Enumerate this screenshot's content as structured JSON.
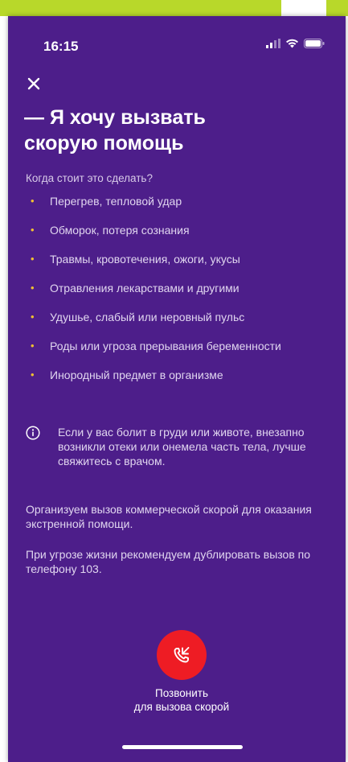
{
  "status": {
    "time": "16:15"
  },
  "header": {
    "close_icon": "close-icon",
    "title_line1": "— Я хочу вызвать",
    "title_line2": "скорую помощь"
  },
  "main": {
    "subtitle": "Когда стоит это сделать?",
    "symptoms": [
      "Перегрев, тепловой удар",
      "Обморок, потеря сознания",
      "Травмы, кровотечения, ожоги, укусы",
      "Отравления лекарствами и другими",
      "Удушье, слабый или неровный пульс",
      "Роды или угроза прерывания беременности",
      "Инородный предмет в организме"
    ],
    "notice": "Если у вас болит в груди или животе, внезапно возникли отеки или онемела часть тела, лучше свяжитесь с врачом.",
    "paragraph1": "Организуем вызов коммерческой скорой для оказания экстренной помощи.",
    "paragraph2": "При угрозе жизни рекомендуем дублировать вызов по телефону 103."
  },
  "call": {
    "icon": "phone-call-icon",
    "caption_line1": "Позвонить",
    "caption_line2": "для вызова скорой"
  },
  "colors": {
    "background": "#4d1e8a",
    "bullet": "#f2c230",
    "call_button": "#ee1c24",
    "frame_accent": "#b8d82a"
  }
}
